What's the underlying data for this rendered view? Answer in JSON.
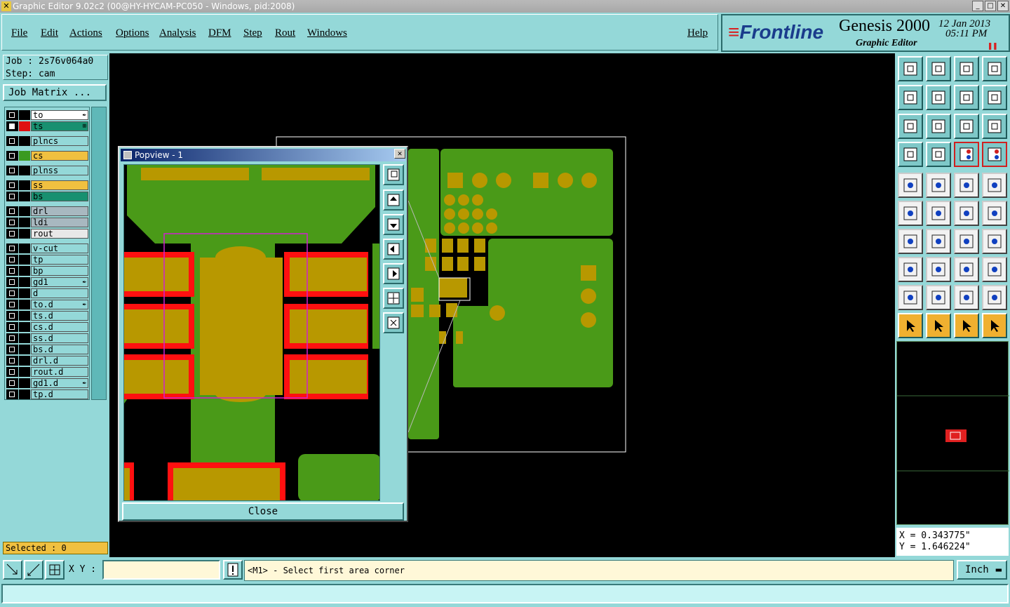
{
  "window": {
    "title": "Graphic Editor 9.02c2 (00@HY-HYCAM-PC050 - Windows, pid:2008)"
  },
  "menu": {
    "items": [
      "File",
      "Edit",
      "Actions",
      "Options",
      "Analysis",
      "DFM",
      "Step",
      "Rout",
      "Windows"
    ],
    "help": "Help"
  },
  "brand": {
    "logo": "Frontline",
    "product": "Genesis 2000",
    "subtitle": "Graphic Editor",
    "date": "12 Jan 2013",
    "time": "05:11 PM"
  },
  "job": {
    "job_line": "Job : 2s76v064a0",
    "step_line": "Step: cam",
    "matrix_button": "Job Matrix ..."
  },
  "layers": [
    {
      "name": "to",
      "color": "#000000",
      "bg": "#ffffff",
      "mark": "✒",
      "checked": false
    },
    {
      "name": "ts",
      "color": "#e01010",
      "bg": "#189070",
      "mark": "⊞",
      "checked": true
    },
    {
      "name": "plncs",
      "color": "#000000",
      "bg": "#94d8d8",
      "mark": "",
      "checked": false
    },
    {
      "name": "cs",
      "color": "#3a9a20",
      "bg": "#f0c040",
      "mark": "",
      "checked": false
    },
    {
      "name": "plnss",
      "color": "#000000",
      "bg": "#94d8d8",
      "mark": "",
      "checked": false
    },
    {
      "name": "ss",
      "color": "#000000",
      "bg": "#f0c040",
      "mark": "",
      "checked": false
    },
    {
      "name": "bs",
      "color": "#000000",
      "bg": "#189070",
      "mark": "",
      "checked": false
    },
    {
      "name": "drl",
      "color": "#000000",
      "bg": "#a8b8c0",
      "mark": "",
      "checked": false
    },
    {
      "name": "ldi",
      "color": "#000000",
      "bg": "#a8b8c0",
      "mark": "",
      "checked": false
    },
    {
      "name": "rout",
      "color": "#000000",
      "bg": "#e8e8e8",
      "mark": "",
      "checked": false
    },
    {
      "name": "v-cut",
      "color": "#000000",
      "bg": "#94d8d8",
      "mark": "",
      "checked": false
    },
    {
      "name": "tp",
      "color": "#000000",
      "bg": "#94d8d8",
      "mark": "",
      "checked": false
    },
    {
      "name": "bp",
      "color": "#000000",
      "bg": "#94d8d8",
      "mark": "",
      "checked": false
    },
    {
      "name": "gd1",
      "color": "#000000",
      "bg": "#94d8d8",
      "mark": "✒",
      "checked": false
    },
    {
      "name": "d",
      "color": "#000000",
      "bg": "#94d8d8",
      "mark": "",
      "checked": false
    },
    {
      "name": "to.d",
      "color": "#000000",
      "bg": "#94d8d8",
      "mark": "✒",
      "checked": false
    },
    {
      "name": "ts.d",
      "color": "#000000",
      "bg": "#94d8d8",
      "mark": "",
      "checked": false
    },
    {
      "name": "cs.d",
      "color": "#000000",
      "bg": "#94d8d8",
      "mark": "",
      "checked": false
    },
    {
      "name": "ss.d",
      "color": "#000000",
      "bg": "#94d8d8",
      "mark": "",
      "checked": false
    },
    {
      "name": "bs.d",
      "color": "#000000",
      "bg": "#94d8d8",
      "mark": "",
      "checked": false
    },
    {
      "name": "drl.d",
      "color": "#000000",
      "bg": "#94d8d8",
      "mark": "",
      "checked": false
    },
    {
      "name": "rout.d",
      "color": "#000000",
      "bg": "#94d8d8",
      "mark": "",
      "checked": false
    },
    {
      "name": "gd1.d",
      "color": "#000000",
      "bg": "#94d8d8",
      "mark": "✒",
      "checked": false
    },
    {
      "name": "tp.d",
      "color": "#000000",
      "bg": "#94d8d8",
      "mark": "",
      "checked": false
    }
  ],
  "selected_text": "Selected : 0",
  "coords": {
    "x": "X = 0.343775\"",
    "y": "Y = 1.646224\""
  },
  "status": {
    "xy_label": "X Y :",
    "xy_value": "",
    "prompt": "<M1> - Select first area corner",
    "unit": "Inch"
  },
  "popview": {
    "title": "Popview - 1",
    "close_label": "Close"
  },
  "colors": {
    "copper": "#4a9a18",
    "pad": "#b89800",
    "mask": "#ff1010",
    "panel": "#94d8d8"
  }
}
